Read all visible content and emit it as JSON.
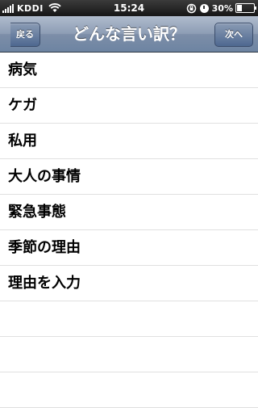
{
  "status_bar": {
    "carrier": "KDDI",
    "time": "15:24",
    "battery_percent": "30%",
    "battery_level": 0.3,
    "icons": [
      "signal-icon",
      "wifi-icon",
      "rotation-lock-icon",
      "alarm-icon",
      "battery-icon"
    ]
  },
  "nav": {
    "title": "どんな言い訳？",
    "back_label": "戻る",
    "next_label": "次へ"
  },
  "list": {
    "items": [
      "病気",
      "ケガ",
      "私用",
      "大人の事情",
      "緊急事態",
      "季節の理由",
      "理由を入力"
    ]
  },
  "colors": {
    "navbar": "#7d8ea8",
    "statusbar": "#161616",
    "separator": "#e0e0e0"
  }
}
